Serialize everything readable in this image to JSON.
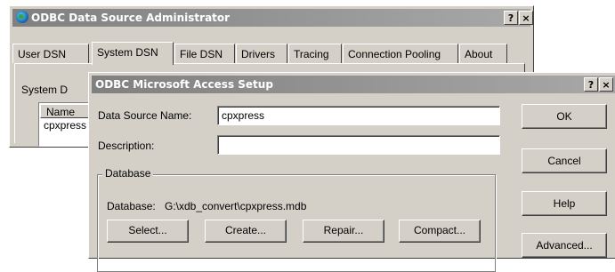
{
  "admin_window": {
    "title": "ODBC Data Source Administrator",
    "help_button": "?",
    "close_button": "×",
    "tabs": [
      {
        "label": "User DSN"
      },
      {
        "label": "System DSN"
      },
      {
        "label": "File DSN"
      },
      {
        "label": "Drivers"
      },
      {
        "label": "Tracing"
      },
      {
        "label": "Connection Pooling"
      },
      {
        "label": "About"
      }
    ],
    "active_tab": "System DSN",
    "system_label": "System D",
    "list": {
      "column_name": "Name",
      "rows": [
        "cpxpress"
      ]
    }
  },
  "setup_dialog": {
    "title": "ODBC Microsoft Access Setup",
    "help_button": "?",
    "close_button": "×",
    "data_source_name_label": "Data Source Name:",
    "data_source_name_value": "cpxpress",
    "description_label": "Description:",
    "description_value": "",
    "database_group_label": "Database",
    "database_path_label": "Database:",
    "database_path_value": "G:\\xdb_convert\\cpxpress.mdb",
    "buttons": {
      "select": "Select...",
      "create": "Create...",
      "repair": "Repair...",
      "compact": "Compact...",
      "ok": "OK",
      "cancel": "Cancel",
      "help": "Help",
      "advanced": "Advanced..."
    }
  }
}
